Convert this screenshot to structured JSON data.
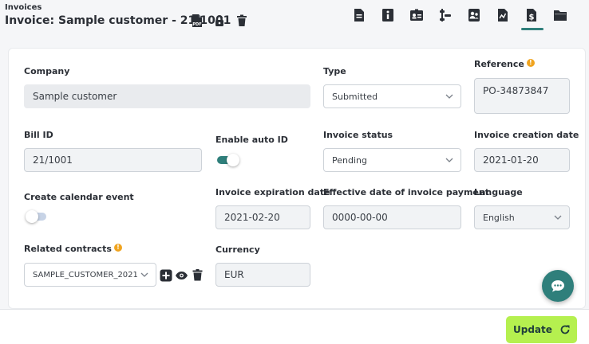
{
  "header": {
    "breadcrumb": "Invoices",
    "title": "Invoice: Sample customer - 21/1001",
    "title_icons": [
      "pdf-icon",
      "unlock-icon",
      "trash-icon"
    ],
    "nav_icons": [
      "document-icon",
      "info-icon",
      "id-card-icon",
      "timeline-icon",
      "contacts-icon",
      "chart-icon",
      "invoice-dollar-icon",
      "folder-icon"
    ],
    "active_nav": "invoice-dollar-icon",
    "pdf_badge": "PDF"
  },
  "form": {
    "company": {
      "label": "Company",
      "value": "Sample customer"
    },
    "type": {
      "label": "Type",
      "value": "Submitted"
    },
    "reference": {
      "label": "Reference",
      "value": "PO-34873847"
    },
    "bill_id": {
      "label": "Bill ID",
      "value": "21/1001"
    },
    "enable_auto_id": {
      "label": "Enable auto ID",
      "checked": true
    },
    "invoice_status": {
      "label": "Invoice status",
      "value": "Pending"
    },
    "invoice_creation_date": {
      "label": "Invoice creation date",
      "value": "2021-01-20"
    },
    "create_calendar_event": {
      "label": "Create calendar event",
      "checked": false
    },
    "invoice_expiration_date": {
      "label": "Invoice expiration date",
      "value": "2021-02-20"
    },
    "effective_payment_date": {
      "label": "Effective date of invoice payment",
      "value": "0000-00-00"
    },
    "language": {
      "label": "Language",
      "value": "English"
    },
    "related_contracts": {
      "label": "Related contracts",
      "value": "SAMPLE_CUSTOMER_2021"
    },
    "currency": {
      "label": "Currency",
      "value": "EUR"
    }
  },
  "footer": {
    "update_label": "Update"
  },
  "colors": {
    "accent": "#2f7f7b",
    "update_button": "#b5f04f",
    "info_badge": "#f0a41f",
    "toggle_off": "#c7d3e6"
  }
}
